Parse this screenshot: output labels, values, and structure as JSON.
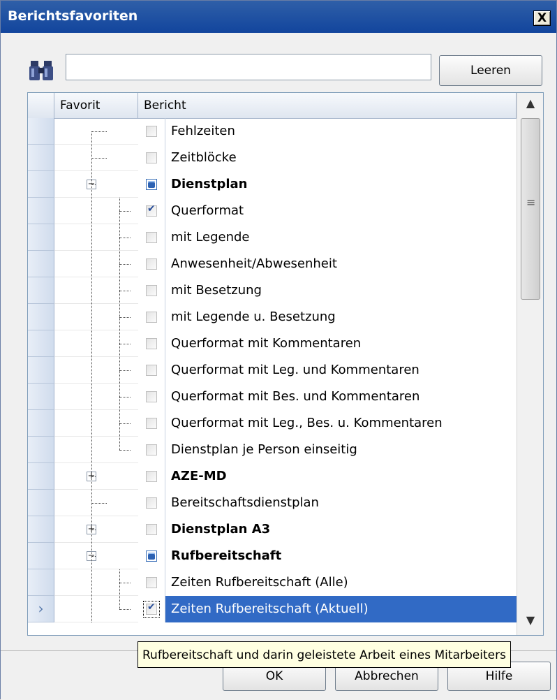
{
  "window": {
    "title": "Berichtsfavoriten",
    "close_label": "X"
  },
  "search": {
    "value": "",
    "placeholder": "",
    "clear_label": "Leeren"
  },
  "grid": {
    "columns": [
      "Favorit",
      "Bericht"
    ],
    "rows": [
      {
        "label": "Fehlzeiten",
        "level": 1,
        "state": "unchecked",
        "group": false
      },
      {
        "label": "Zeitblöcke",
        "level": 1,
        "state": "unchecked",
        "group": false
      },
      {
        "label": "Dienstplan",
        "level": 1,
        "state": "partial",
        "group": true,
        "expander": "−"
      },
      {
        "label": "Querformat",
        "level": 2,
        "state": "checked",
        "group": false
      },
      {
        "label": "mit Legende",
        "level": 2,
        "state": "unchecked",
        "group": false
      },
      {
        "label": "Anwesenheit/Abwesenheit",
        "level": 2,
        "state": "unchecked",
        "group": false
      },
      {
        "label": "mit Besetzung",
        "level": 2,
        "state": "unchecked",
        "group": false
      },
      {
        "label": "mit Legende u. Besetzung",
        "level": 2,
        "state": "unchecked",
        "group": false
      },
      {
        "label": "Querformat mit Kommentaren",
        "level": 2,
        "state": "unchecked",
        "group": false
      },
      {
        "label": "Querformat  mit Leg. und Kommentaren",
        "level": 2,
        "state": "unchecked",
        "group": false
      },
      {
        "label": "Querformat  mit Bes. und Kommentaren",
        "level": 2,
        "state": "unchecked",
        "group": false
      },
      {
        "label": "Querformat  mit Leg., Bes. u. Kommentaren",
        "level": 2,
        "state": "unchecked",
        "group": false
      },
      {
        "label": "Dienstplan je Person einseitig",
        "level": 2,
        "state": "unchecked",
        "group": false
      },
      {
        "label": "AZE-MD",
        "level": 1,
        "state": "unchecked",
        "group": true,
        "expander": "+"
      },
      {
        "label": "Bereitschaftsdienstplan",
        "level": 1,
        "state": "unchecked",
        "group": false
      },
      {
        "label": "Dienstplan A3",
        "level": 1,
        "state": "unchecked",
        "group": true,
        "expander": "+"
      },
      {
        "label": "Rufbereitschaft",
        "level": 1,
        "state": "partial",
        "group": true,
        "expander": "−"
      },
      {
        "label": "Zeiten Rufbereitschaft (Alle)",
        "level": 2,
        "state": "unchecked",
        "group": false
      },
      {
        "label": "Zeiten Rufbereitschaft (Aktuell)",
        "level": 2,
        "state": "checked",
        "group": false,
        "selected": true
      }
    ]
  },
  "tooltip": {
    "text": "Rufbereitschaft und darin geleistete Arbeit eines Mitarbeiters"
  },
  "buttons": {
    "ok": "OK",
    "cancel": "Abbrechen",
    "help": "Hilfe"
  },
  "colors": {
    "titlebar": "#12459d",
    "selection": "#316ac5",
    "tooltip_bg": "#ffffe1"
  }
}
